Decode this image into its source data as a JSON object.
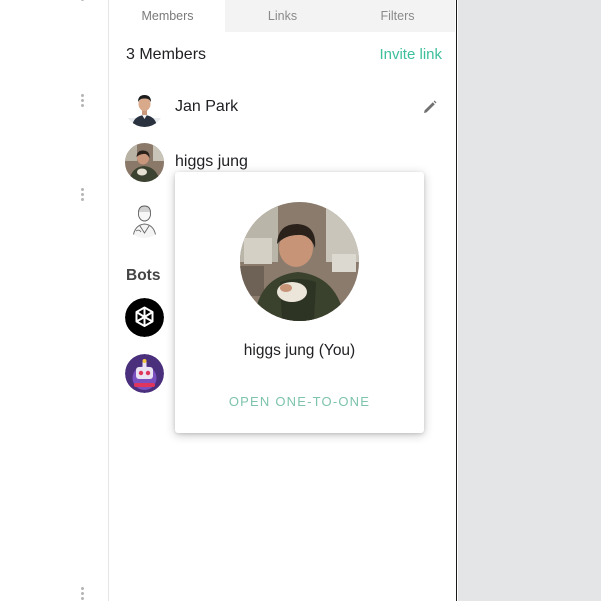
{
  "tabs": [
    {
      "label": "Members",
      "active": true
    },
    {
      "label": "Links",
      "active": false
    },
    {
      "label": "Filters",
      "active": false
    }
  ],
  "members_header": {
    "count_label": "3 Members",
    "invite_label": "Invite link"
  },
  "members": [
    {
      "name": "Jan Park",
      "editable": true,
      "avatar_icon": "person-photo"
    },
    {
      "name": "higgs jung",
      "editable": false,
      "avatar_icon": "person-photo"
    },
    {
      "name": "",
      "editable": false,
      "avatar_icon": "sketch-person"
    }
  ],
  "bots": {
    "heading": "Bots",
    "items": [
      {
        "icon": "openai-logo-icon"
      },
      {
        "icon": "robot-bot-icon"
      }
    ]
  },
  "popup": {
    "name": "higgs jung (You)",
    "action_label": "OPEN ONE-TO-ONE"
  },
  "colors": {
    "accent": "#3dbf9c",
    "popup_action": "#7dc3ad",
    "tab_bar": "#f3f3f3",
    "backdrop": "#e4e5e7"
  }
}
